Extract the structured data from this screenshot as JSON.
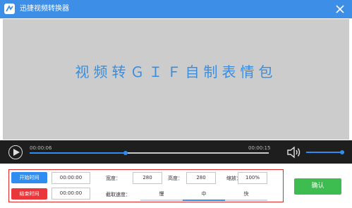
{
  "window": {
    "title": "迅捷视频转换器",
    "accent_color": "#3d8ee6"
  },
  "icons": {
    "logo": "app-logo-icon",
    "close": "close-icon",
    "play": "play-icon",
    "volume": "volume-icon"
  },
  "preview": {
    "overlay_text": "视频转ＧＩＦ自制表情包"
  },
  "player": {
    "current_time": "00:00:06",
    "total_time": "00:00:15",
    "progress": 0.4,
    "volume": 0.95
  },
  "settings": {
    "start_button": "开始时间",
    "end_button": "结束时间",
    "start_time": "00:00:00",
    "end_time": "00:00:00",
    "width_label": "宽度：",
    "width_value": "280",
    "height_label": "高度：",
    "height_value": "280",
    "zoom_label": "缩放：",
    "zoom_value": "100%",
    "speed_label": "截取速度：",
    "speed_options": [
      "慢",
      "中",
      "快"
    ],
    "speed_selected": "中"
  },
  "confirm_button": "确认"
}
